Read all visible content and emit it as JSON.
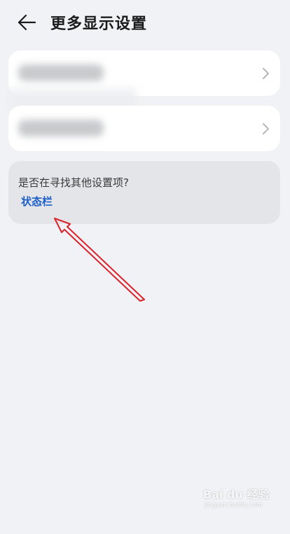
{
  "header": {
    "title": "更多显示设置",
    "back_icon": "arrow-left-icon"
  },
  "settings_list": [
    {
      "label": "",
      "label_obscured": true,
      "chevron_icon": "chevron-right-icon"
    },
    {
      "label": "",
      "label_obscured": true,
      "chevron_icon": "chevron-right-icon"
    }
  ],
  "suggestion": {
    "question": "是否在寻找其他设置项?",
    "link_label": "状态栏"
  },
  "annotation": {
    "arrow_color": "#d9232d"
  },
  "watermark": {
    "brand": "Bai du 经验",
    "url": "jingyan.baidu.com"
  },
  "colors": {
    "background": "#f1f2f5",
    "card": "#ffffff",
    "suggestion_card": "#e4e5e8",
    "link": "#1b5dc9"
  }
}
